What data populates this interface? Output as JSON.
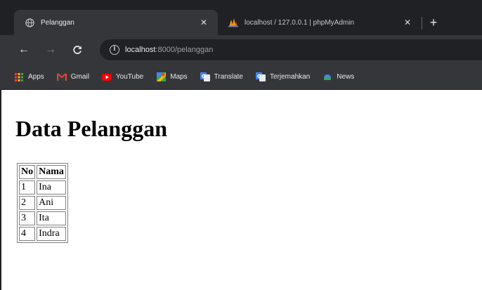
{
  "tabs": [
    {
      "title": "Pelanggan",
      "icon": "globe-icon",
      "active": true
    },
    {
      "title": "localhost / 127.0.0.1 | phpMyAdmin",
      "icon": "phpmyadmin-icon",
      "active": false
    }
  ],
  "toolbar": {
    "url_host": "localhost",
    "url_rest": ":8000/pelanggan"
  },
  "bookmarks": [
    {
      "label": "Apps",
      "icon": "apps-grid-icon"
    },
    {
      "label": "Gmail",
      "icon": "gmail-icon"
    },
    {
      "label": "YouTube",
      "icon": "youtube-icon"
    },
    {
      "label": "Maps",
      "icon": "maps-icon"
    },
    {
      "label": "Translate",
      "icon": "translate-icon"
    },
    {
      "label": "Terjemahkan",
      "icon": "translate-icon"
    },
    {
      "label": "News",
      "icon": "news-icon"
    }
  ],
  "page": {
    "title": "Data Pelanggan",
    "table": {
      "headers": [
        "No",
        "Nama"
      ],
      "rows": [
        [
          "1",
          "Ina"
        ],
        [
          "2",
          "Ani"
        ],
        [
          "3",
          "Ita"
        ],
        [
          "4",
          "Indra"
        ]
      ]
    }
  },
  "colors": {
    "tabstrip": "#202124",
    "toolbar": "#35363a",
    "omnibox": "#202124"
  }
}
